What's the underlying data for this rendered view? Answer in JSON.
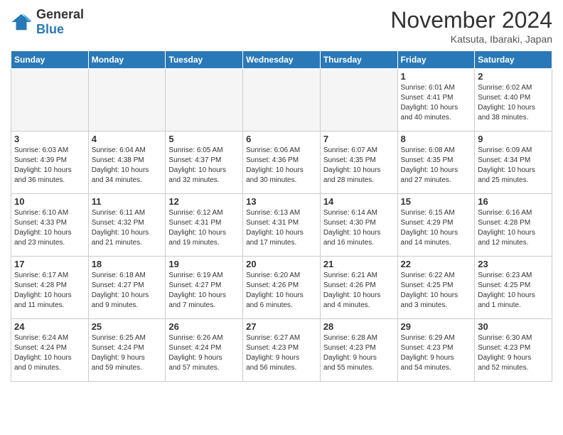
{
  "header": {
    "logo_line1": "General",
    "logo_line2": "Blue",
    "month": "November 2024",
    "location": "Katsuta, Ibaraki, Japan"
  },
  "days": [
    "Sunday",
    "Monday",
    "Tuesday",
    "Wednesday",
    "Thursday",
    "Friday",
    "Saturday"
  ],
  "weeks": [
    [
      {
        "day": "",
        "info": ""
      },
      {
        "day": "",
        "info": ""
      },
      {
        "day": "",
        "info": ""
      },
      {
        "day": "",
        "info": ""
      },
      {
        "day": "",
        "info": ""
      },
      {
        "day": "1",
        "info": "Sunrise: 6:01 AM\nSunset: 4:41 PM\nDaylight: 10 hours\nand 40 minutes."
      },
      {
        "day": "2",
        "info": "Sunrise: 6:02 AM\nSunset: 4:40 PM\nDaylight: 10 hours\nand 38 minutes."
      }
    ],
    [
      {
        "day": "3",
        "info": "Sunrise: 6:03 AM\nSunset: 4:39 PM\nDaylight: 10 hours\nand 36 minutes."
      },
      {
        "day": "4",
        "info": "Sunrise: 6:04 AM\nSunset: 4:38 PM\nDaylight: 10 hours\nand 34 minutes."
      },
      {
        "day": "5",
        "info": "Sunrise: 6:05 AM\nSunset: 4:37 PM\nDaylight: 10 hours\nand 32 minutes."
      },
      {
        "day": "6",
        "info": "Sunrise: 6:06 AM\nSunset: 4:36 PM\nDaylight: 10 hours\nand 30 minutes."
      },
      {
        "day": "7",
        "info": "Sunrise: 6:07 AM\nSunset: 4:35 PM\nDaylight: 10 hours\nand 28 minutes."
      },
      {
        "day": "8",
        "info": "Sunrise: 6:08 AM\nSunset: 4:35 PM\nDaylight: 10 hours\nand 27 minutes."
      },
      {
        "day": "9",
        "info": "Sunrise: 6:09 AM\nSunset: 4:34 PM\nDaylight: 10 hours\nand 25 minutes."
      }
    ],
    [
      {
        "day": "10",
        "info": "Sunrise: 6:10 AM\nSunset: 4:33 PM\nDaylight: 10 hours\nand 23 minutes."
      },
      {
        "day": "11",
        "info": "Sunrise: 6:11 AM\nSunset: 4:32 PM\nDaylight: 10 hours\nand 21 minutes."
      },
      {
        "day": "12",
        "info": "Sunrise: 6:12 AM\nSunset: 4:31 PM\nDaylight: 10 hours\nand 19 minutes."
      },
      {
        "day": "13",
        "info": "Sunrise: 6:13 AM\nSunset: 4:31 PM\nDaylight: 10 hours\nand 17 minutes."
      },
      {
        "day": "14",
        "info": "Sunrise: 6:14 AM\nSunset: 4:30 PM\nDaylight: 10 hours\nand 16 minutes."
      },
      {
        "day": "15",
        "info": "Sunrise: 6:15 AM\nSunset: 4:29 PM\nDaylight: 10 hours\nand 14 minutes."
      },
      {
        "day": "16",
        "info": "Sunrise: 6:16 AM\nSunset: 4:28 PM\nDaylight: 10 hours\nand 12 minutes."
      }
    ],
    [
      {
        "day": "17",
        "info": "Sunrise: 6:17 AM\nSunset: 4:28 PM\nDaylight: 10 hours\nand 11 minutes."
      },
      {
        "day": "18",
        "info": "Sunrise: 6:18 AM\nSunset: 4:27 PM\nDaylight: 10 hours\nand 9 minutes."
      },
      {
        "day": "19",
        "info": "Sunrise: 6:19 AM\nSunset: 4:27 PM\nDaylight: 10 hours\nand 7 minutes."
      },
      {
        "day": "20",
        "info": "Sunrise: 6:20 AM\nSunset: 4:26 PM\nDaylight: 10 hours\nand 6 minutes."
      },
      {
        "day": "21",
        "info": "Sunrise: 6:21 AM\nSunset: 4:26 PM\nDaylight: 10 hours\nand 4 minutes."
      },
      {
        "day": "22",
        "info": "Sunrise: 6:22 AM\nSunset: 4:25 PM\nDaylight: 10 hours\nand 3 minutes."
      },
      {
        "day": "23",
        "info": "Sunrise: 6:23 AM\nSunset: 4:25 PM\nDaylight: 10 hours\nand 1 minute."
      }
    ],
    [
      {
        "day": "24",
        "info": "Sunrise: 6:24 AM\nSunset: 4:24 PM\nDaylight: 10 hours\nand 0 minutes."
      },
      {
        "day": "25",
        "info": "Sunrise: 6:25 AM\nSunset: 4:24 PM\nDaylight: 9 hours\nand 59 minutes."
      },
      {
        "day": "26",
        "info": "Sunrise: 6:26 AM\nSunset: 4:24 PM\nDaylight: 9 hours\nand 57 minutes."
      },
      {
        "day": "27",
        "info": "Sunrise: 6:27 AM\nSunset: 4:23 PM\nDaylight: 9 hours\nand 56 minutes."
      },
      {
        "day": "28",
        "info": "Sunrise: 6:28 AM\nSunset: 4:23 PM\nDaylight: 9 hours\nand 55 minutes."
      },
      {
        "day": "29",
        "info": "Sunrise: 6:29 AM\nSunset: 4:23 PM\nDaylight: 9 hours\nand 54 minutes."
      },
      {
        "day": "30",
        "info": "Sunrise: 6:30 AM\nSunset: 4:23 PM\nDaylight: 9 hours\nand 52 minutes."
      }
    ]
  ]
}
